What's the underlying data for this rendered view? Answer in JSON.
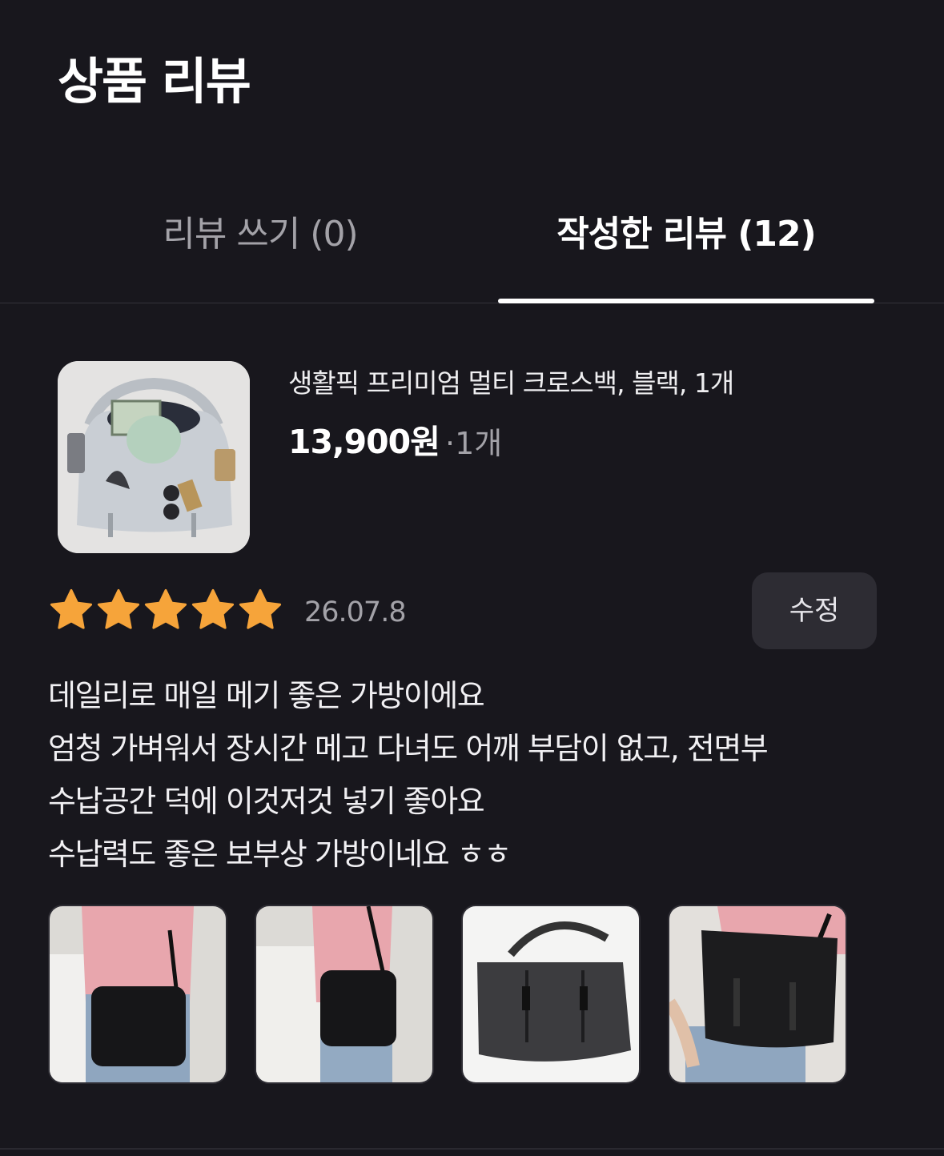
{
  "header": {
    "title": "상품 리뷰"
  },
  "tabs": [
    {
      "label": "리뷰 쓰기 (0)",
      "active": false
    },
    {
      "label": "작성한 리뷰 (12)",
      "active": true
    }
  ],
  "review": {
    "product": {
      "name": "생활픽 프리미엄 멀티 크로스백, 블랙, 1개",
      "price": "13,900원",
      "quantity": "·1개",
      "thumbnail_icon": "gray-crossbag-photo"
    },
    "rating": 5,
    "rating_max": 5,
    "date": "26.07.8",
    "edit_label": "수정",
    "text_lines": [
      "데일리로 매일 메기 좋은 가방이에요",
      "엄청 가벼워서 장시간 메고 다녀도 어깨 부담이 없고, 전면부",
      "수납공간 덕에 이것저것 넣기 좋아요",
      "수납력도 좋은 보부상 가방이네요 ㅎㅎ"
    ],
    "photos": [
      {
        "icon": "model-wearing-black-bag-front-photo"
      },
      {
        "icon": "model-wearing-black-bag-side-photo"
      },
      {
        "icon": "black-bag-product-photo"
      },
      {
        "icon": "model-wearing-black-bag-closeup-photo"
      }
    ]
  },
  "colors": {
    "background": "#18171d",
    "star": "#f6a43a",
    "muted_text": "#a3a2a8",
    "button_bg": "#2d2c33"
  }
}
